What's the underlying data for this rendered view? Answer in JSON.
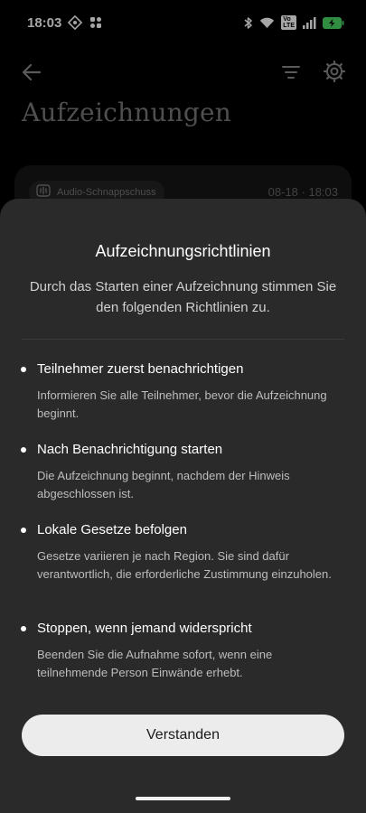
{
  "status_bar": {
    "time": "18:03",
    "left_icons": [
      "vpn-diamond-icon",
      "app-notification-icon"
    ],
    "right_icons": [
      "bluetooth-icon",
      "wifi-icon",
      "volte-badge-icon",
      "cellular-signal-icon",
      "battery-charging-icon"
    ],
    "volte_line1": "Vo",
    "volte_line2": "LTE",
    "battery_color": "#4cd964"
  },
  "header": {
    "back_icon": "arrow-left-icon",
    "filter_icon": "filter-icon",
    "settings_icon": "settings-gear-icon",
    "title": "Aufzeichnungen"
  },
  "recording_card": {
    "chip_icon": "audio-snapshot-icon",
    "chip_label": "Audio-Schnappschuss",
    "timestamp": "08-18 · 18:03"
  },
  "sheet": {
    "title": "Aufzeichnungsrichtlinien",
    "subtitle": "Durch das Starten einer Aufzeichnung stimmen Sie den folgenden Richtlinien zu.",
    "rules": [
      {
        "heading": "Teilnehmer zuerst benachrichtigen",
        "body": "Informieren Sie alle Teilnehmer, bevor die Aufzeichnung beginnt."
      },
      {
        "heading": "Nach Benachrichtigung starten",
        "body": "Die Aufzeichnung beginnt, nachdem der Hinweis abgeschlossen ist."
      },
      {
        "heading": "Lokale Gesetze befolgen",
        "body": "Gesetze variieren je nach Region. Sie sind dafür verantwortlich, die erforderliche Zustimmung einzuholen."
      },
      {
        "heading": "Stoppen, wenn jemand widerspricht",
        "body": "Beenden Sie die Aufnahme sofort, wenn eine teilnehmende Person Einwände erhebt."
      }
    ],
    "confirm_label": "Verstanden"
  },
  "colors": {
    "background": "#000000",
    "sheet": "#2a2a2a",
    "button": "#ececec",
    "muted_text": "#bdbdbd"
  }
}
